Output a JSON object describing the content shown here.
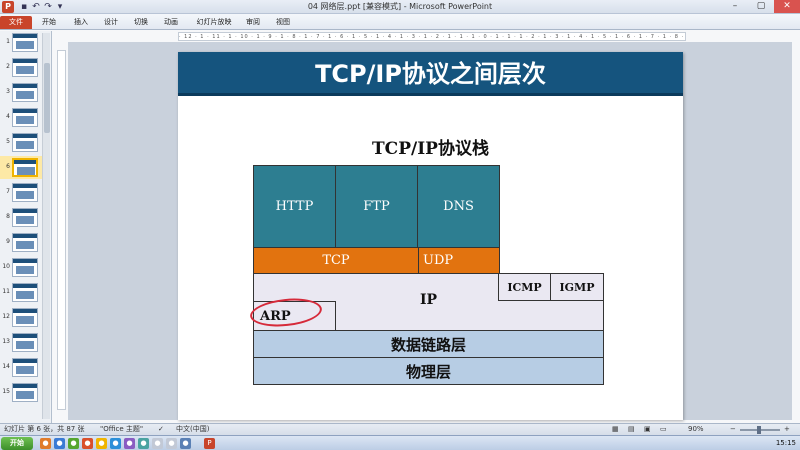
{
  "window": {
    "app_icon": "P",
    "title": "04 网络层.ppt [兼容模式] - Microsoft PowerPoint",
    "qat": [
      "save-icon",
      "undo-icon",
      "redo-icon",
      "customize-icon"
    ]
  },
  "ribbon": {
    "tabs": [
      "文件",
      "开始",
      "插入",
      "设计",
      "切换",
      "动画",
      "幻灯片放映",
      "审阅",
      "视图"
    ]
  },
  "thumbnails": {
    "numbers": [
      "1",
      "2",
      "3",
      "4",
      "5",
      "6",
      "7",
      "8",
      "9",
      "10",
      "11",
      "12",
      "13",
      "14",
      "15"
    ],
    "selected": "6"
  },
  "ruler": {
    "text": "· 12 · 1 · 11 · 1 · 10 · 1 · 9 · 1 · 8 · 1 · 7 · 1 · 6 · 1 · 5 · 1 · 4 · 1 · 3 · 1 · 2 · 1 · 1 · 1 · 0 · 1 · 1 · 1 · 2 · 1 · 3 · 1 · 4 · 1 · 5 · 1 · 6 · 1 · 7 · 1 · 8 · 1 · 9 ·"
  },
  "slide": {
    "title": "TCP/IP协议之间层次",
    "stack_title": "TCP/IP协议栈",
    "app_layer": [
      "HTTP",
      "FTP",
      "DNS"
    ],
    "transport_layer": [
      "TCP",
      "UDP"
    ],
    "ip": "IP",
    "icmp": "ICMP",
    "igmp": "IGMP",
    "arp": "ARP",
    "data_link": "数据链路层",
    "physical": "物理层"
  },
  "status": {
    "slide_info": "幻灯片 第 6 张，共 87 张",
    "theme": "\"Office 主题\"",
    "language": "中文(中国)",
    "zoom": "90%"
  },
  "taskbar": {
    "start": "开始",
    "clock": "15:15"
  },
  "colors": {
    "title_bar": "#15547e",
    "app_layer": "#2d7e91",
    "transport_layer": "#e2730f",
    "network_layer": "#eae8f2",
    "link_layer": "#b7cde4",
    "annotation": "#d62a3a"
  }
}
